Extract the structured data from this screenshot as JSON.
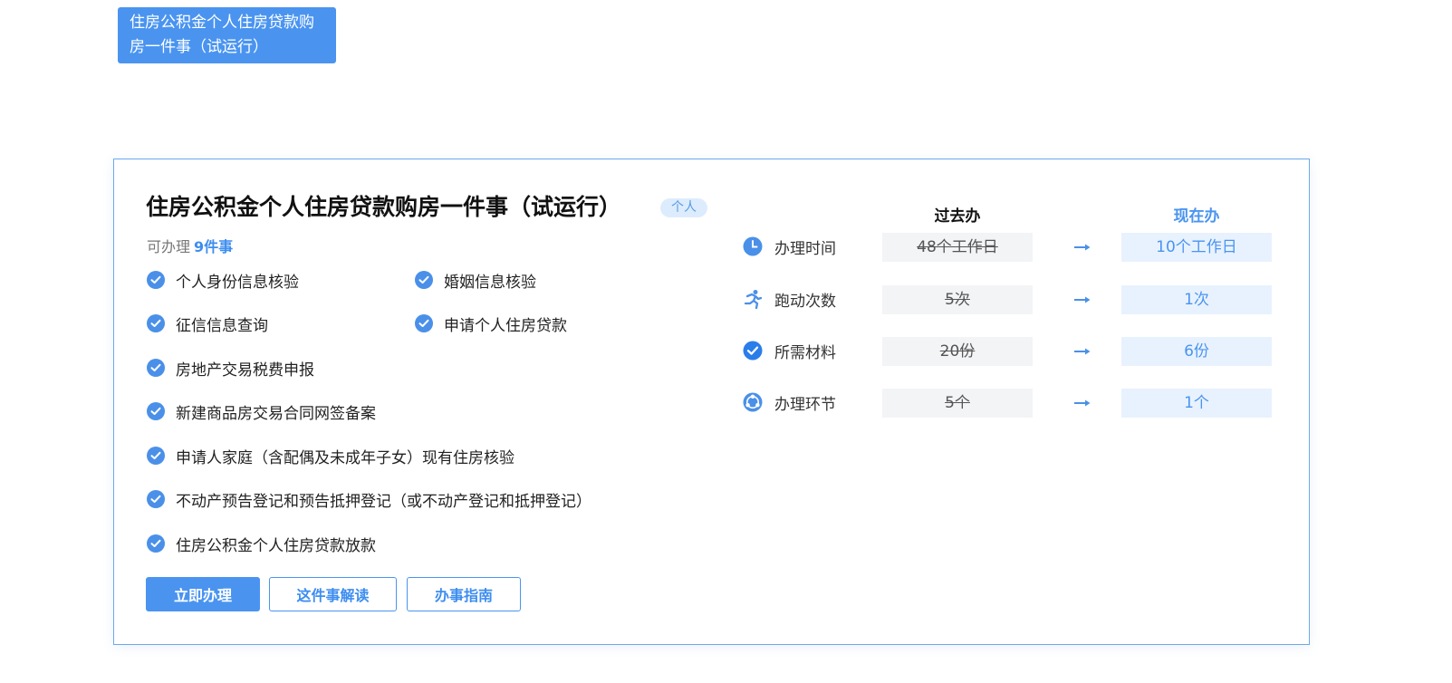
{
  "tab": {
    "label": "住房公积金个人住房贷款购房一件事（试运行）"
  },
  "card": {
    "title": "住房公积金个人住房贷款购房一件事（试运行）",
    "badge": "个人",
    "count_prefix": "可办理",
    "count_value": "9件事",
    "items": [
      "个人身份信息核验",
      "婚姻信息核验",
      "征信信息查询",
      "申请个人住房贷款",
      "房地产交易税费申报",
      "新建商品房交易合同网签备案",
      "申请人家庭（含配偶及未成年子女）现有住房核验",
      "不动产预告登记和预告抵押登记（或不动产登记和抵押登记）",
      "住房公积金个人住房贷款放款"
    ],
    "buttons": {
      "apply": "立即办理",
      "explain": "这件事解读",
      "guide": "办事指南"
    }
  },
  "comparison": {
    "past_header": "过去办",
    "now_header": "现在办",
    "rows": [
      {
        "label": "办理时间",
        "icon": "clock-icon",
        "past": "48个工作日",
        "now": "10个工作日"
      },
      {
        "label": "跑动次数",
        "icon": "running-icon",
        "past": "5次",
        "now": "1次"
      },
      {
        "label": "所需材料",
        "icon": "check-circle-icon",
        "past": "20份",
        "now": "6份"
      },
      {
        "label": "办理环节",
        "icon": "steps-icon",
        "past": "5个",
        "now": "1个"
      }
    ]
  },
  "colors": {
    "accent": "#4a94f0",
    "border": "#6aa9ee",
    "now_bg": "#e8f2fe",
    "past_bg": "#f3f4f6"
  }
}
